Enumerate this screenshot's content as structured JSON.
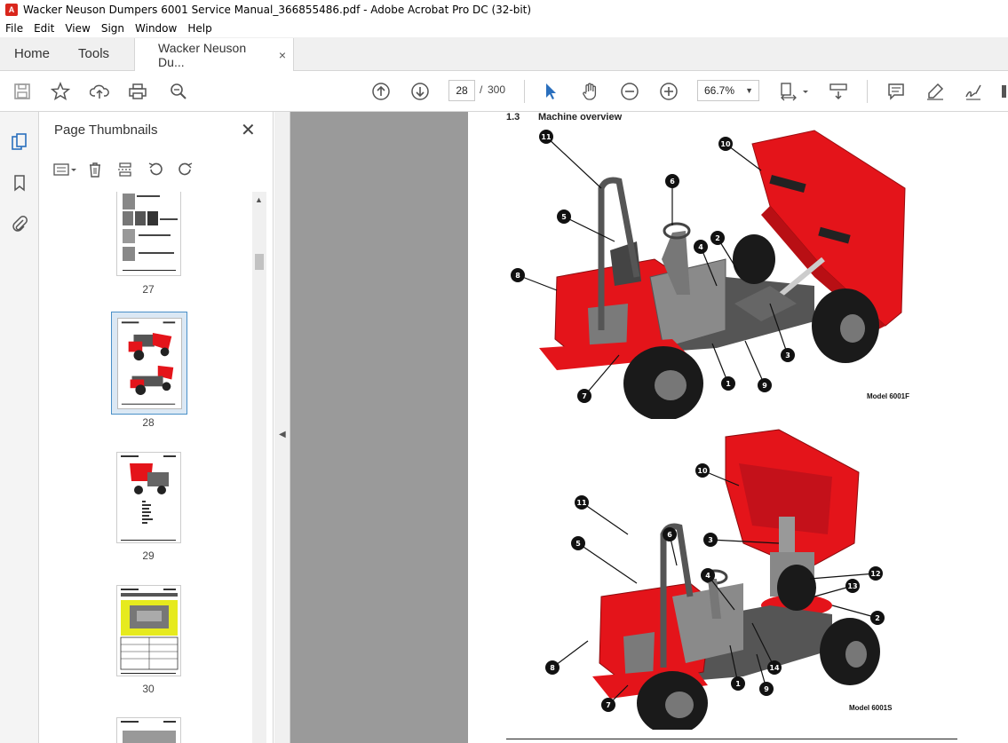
{
  "window": {
    "title": "Wacker Neuson Dumpers 6001 Service Manual_366855486.pdf - Adobe Acrobat Pro DC (32-bit)",
    "app_icon": "acrobat-icon"
  },
  "menu": [
    "File",
    "Edit",
    "View",
    "Sign",
    "Window",
    "Help"
  ],
  "tabs": {
    "home": "Home",
    "tools": "Tools",
    "document": "Wacker Neuson Du...",
    "close": "×"
  },
  "toolbar": {
    "page_current": "28",
    "page_sep": "/",
    "page_total": "300",
    "zoom": "66.7%",
    "icons": [
      "save-icon",
      "star-icon",
      "upload-icon",
      "print-icon",
      "search-zoom-icon",
      "prev-page-icon",
      "next-page-icon",
      "select-arrow-icon",
      "hand-icon",
      "zoom-out-icon",
      "zoom-in-icon",
      "fit-page-icon",
      "scroll-mode-icon",
      "comment-icon",
      "highlight-icon",
      "sign-icon"
    ]
  },
  "thumbnails_panel": {
    "title": "Page Thumbnails",
    "close": "✕",
    "pages": [
      {
        "label": "27"
      },
      {
        "label": "28",
        "selected": true
      },
      {
        "label": "29"
      },
      {
        "label": "30"
      }
    ]
  },
  "document": {
    "section_number": "1.3",
    "section_title": "Machine overview",
    "model_top": "Model 6001F",
    "model_bottom": "Model 6001S",
    "callouts_top": [
      "11",
      "10",
      "6",
      "5",
      "4",
      "2",
      "8",
      "3",
      "1",
      "9",
      "7"
    ],
    "callouts_bottom": [
      "10",
      "11",
      "6",
      "3",
      "5",
      "12",
      "4",
      "13",
      "2",
      "8",
      "14",
      "1",
      "9",
      "7"
    ]
  },
  "colors": {
    "accent_blue": "#2a6fbd",
    "dumper_red": "#e4141a",
    "doc_background": "#9a9a9a"
  }
}
